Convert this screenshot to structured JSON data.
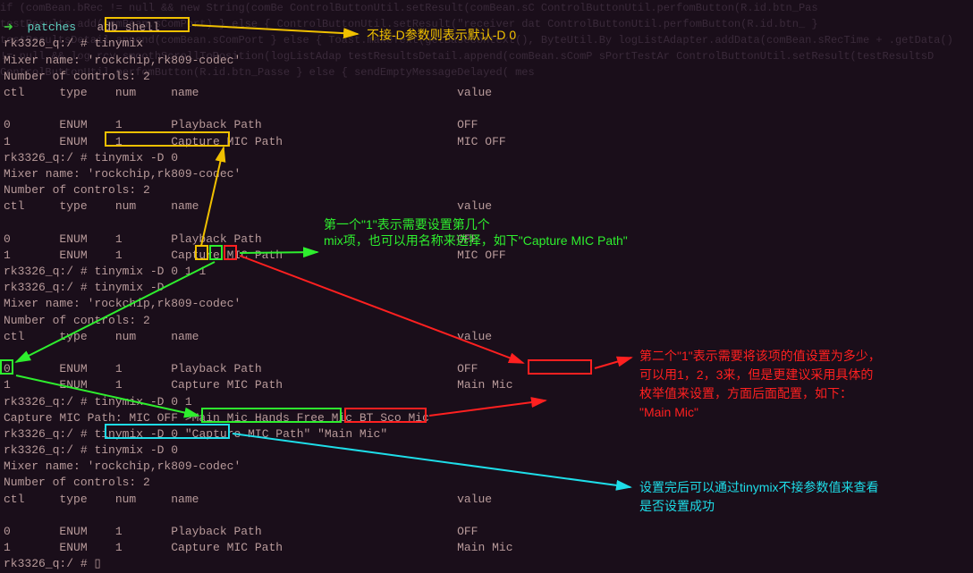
{
  "header": {
    "branch": "patches",
    "cmd": "adb shell"
  },
  "prompt": "rk3326_q:/ #",
  "cmds": {
    "tinymix": "tinymix",
    "tinymixD0": "tinymix -D 0",
    "tinymixD": "tinymix -D",
    "arg0": "0",
    "arg1a": "1",
    "arg1b": "1",
    "tinymixD01": "tinymix -D 0 1",
    "capPath": "\"Capture MIC Path\"",
    "mainMic": "\"Main Mic\"",
    "cursor": "▯"
  },
  "mixer": {
    "name": "Mixer name: 'rockchip,rk809-codec'",
    "count": "Number of controls: 2",
    "header": "ctl     type    num     name                                     value"
  },
  "rows": {
    "r0off": "0       ENUM    1       Playback Path                            OFF",
    "r1micoff": "1       ENUM    1       Capture MIC Path                         MIC OFF",
    "r0off_b": "0       ENUM    1       Playback Path                            OFF",
    "idx1": "1",
    "r1main_rest": "       ENUM    1       Capture MIC Path                         ",
    "mainmic_val": "Main Mic",
    "capline": "Capture MIC Path: MIC OFF >Main Mic Hands Free Mic BT Sco Mic",
    "r1main_full": "1       ENUM    1       Capture MIC Path                         Main Mic"
  },
  "annotations": {
    "a1": "不接-D参数则表示默认-D 0",
    "a2": "第一个\"1\"表示需要设置第几个\nmix项，也可以用名称来选择，如下\"Capture MIC Path\"",
    "a3": "第二个\"1\"表示需要将该项的值设置为多少，\n可以用1，2，3来，但是更建议采用具体的\n枚举值来设置，方面后面配置，如下：\n\"Main Mic\"",
    "a4": "设置完后可以通过tinymix不接参数值来查看\n是否设置成功"
  },
  "ghost": "if (comBean.bRec != null && new String(comBe\n  ControlButtonUtil.setResult(comBean.sC\n  ControlButtonUtil.perfomButton(R.id.btn_Pas\n  testResults.add(comBean.sComPort)\n} else {\n  ControlButtonUtil.setResult(\"receiver dat\n  ControlButtonUtil.perfomButton(R.id.btn_\n}\ntestResultsDetail.append(comBean.sComPort\n\n} else {\nToast.makeText(getBaseContext(), ByteUtil.By\nlogListAdapter.addData(comBean.sRecTime + \n        .getData() != null && log\nrcy.smoothScrollToPosition(logListAdap\n\ntestResultsDetail.append(comBean.sComP\n\n\n\n\n                                        sPortTestAr\nControlButtonUtil.setResult(testResultsD\nControlButtonUtil.perfomButton(R.id.btn_Passe\n} else {\n         sendEmptyMessageDelayed( mes"
}
